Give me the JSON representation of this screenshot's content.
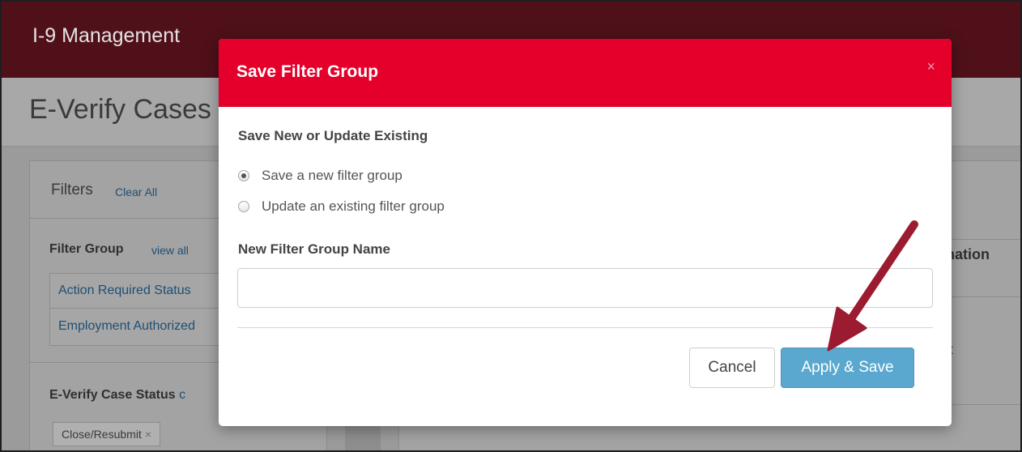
{
  "app": {
    "title": "I-9 Management"
  },
  "page": {
    "title": "E-Verify Cases"
  },
  "filters": {
    "title": "Filters",
    "clear_all": "Clear All",
    "filter_group_label": "Filter Group",
    "view_all": "view all",
    "groups": [
      {
        "label": "Action Required Status"
      },
      {
        "label": "Employment Authorized"
      }
    ],
    "case_status_label": "E-Verify Case Status",
    "case_status_link_fragment": "c",
    "tags": [
      {
        "label": "Close/Resubmit",
        "remove_icon": "×"
      }
    ]
  },
  "results": {
    "column_fragment": "nation",
    "cell_fragment": "t"
  },
  "modal": {
    "title": "Save Filter Group",
    "close_icon": "×",
    "subhead": "Save New or Update Existing",
    "options": [
      {
        "label": "Save a new filter group",
        "checked": true
      },
      {
        "label": "Update an existing filter group",
        "checked": false
      }
    ],
    "name_label": "New Filter Group Name",
    "name_value": "",
    "cancel_label": "Cancel",
    "apply_label": "Apply & Save"
  },
  "colors": {
    "modal_header": "#e4002b",
    "app_bar": "#4f1019",
    "primary_button": "#5aa8cf",
    "annotation_arrow": "#9b1b30"
  },
  "annotation": {
    "icon": "arrow-icon"
  }
}
